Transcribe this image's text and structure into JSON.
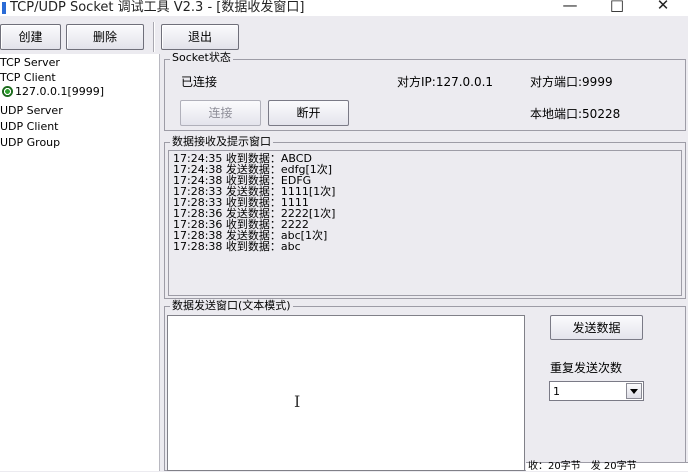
{
  "window": {
    "title": "TCP/UDP Socket 调试工具 V2.3 - [数据收发窗口]",
    "minimize": "—",
    "maximize": "□",
    "close": "✕"
  },
  "toolbar": {
    "create": "创建",
    "delete": "删除",
    "exit": "退出"
  },
  "tree": {
    "items": [
      "TCP Server",
      "TCP Client",
      "127.0.0.1[9999]",
      "UDP Server",
      "UDP Client",
      "UDP Group"
    ]
  },
  "socket": {
    "group_title": "Socket状态",
    "status": "已连接",
    "remote_ip": "对方IP:127.0.0.1",
    "remote_port": "对方端口:9999",
    "local_port": "本地端口:50228",
    "connect_btn": "连接",
    "disconnect_btn": "断开"
  },
  "receive": {
    "group_title": "数据接收及提示窗口",
    "lines": [
      "17:24:35 收到数据：ABCD",
      "17:24:38 发送数据：edfg[1次]",
      "17:24:38 收到数据：EDFG",
      "17:28:33 发送数据：1111[1次]",
      "17:28:33 收到数据：1111",
      "17:28:36 发送数据：2222[1次]",
      "17:28:36 收到数据：2222",
      "17:28:38 发送数据：abc[1次]",
      "17:28:38 收到数据：abc"
    ]
  },
  "send": {
    "group_title": "数据发送窗口(文本模式)",
    "send_btn": "发送数据",
    "repeat_label": "重复发送次数",
    "repeat_value": "1"
  },
  "status_bar": {
    "text": "收：20字节　发 20字节"
  },
  "colors": {
    "background": "#ecebf0",
    "connected_icon": "#2fa12f"
  }
}
